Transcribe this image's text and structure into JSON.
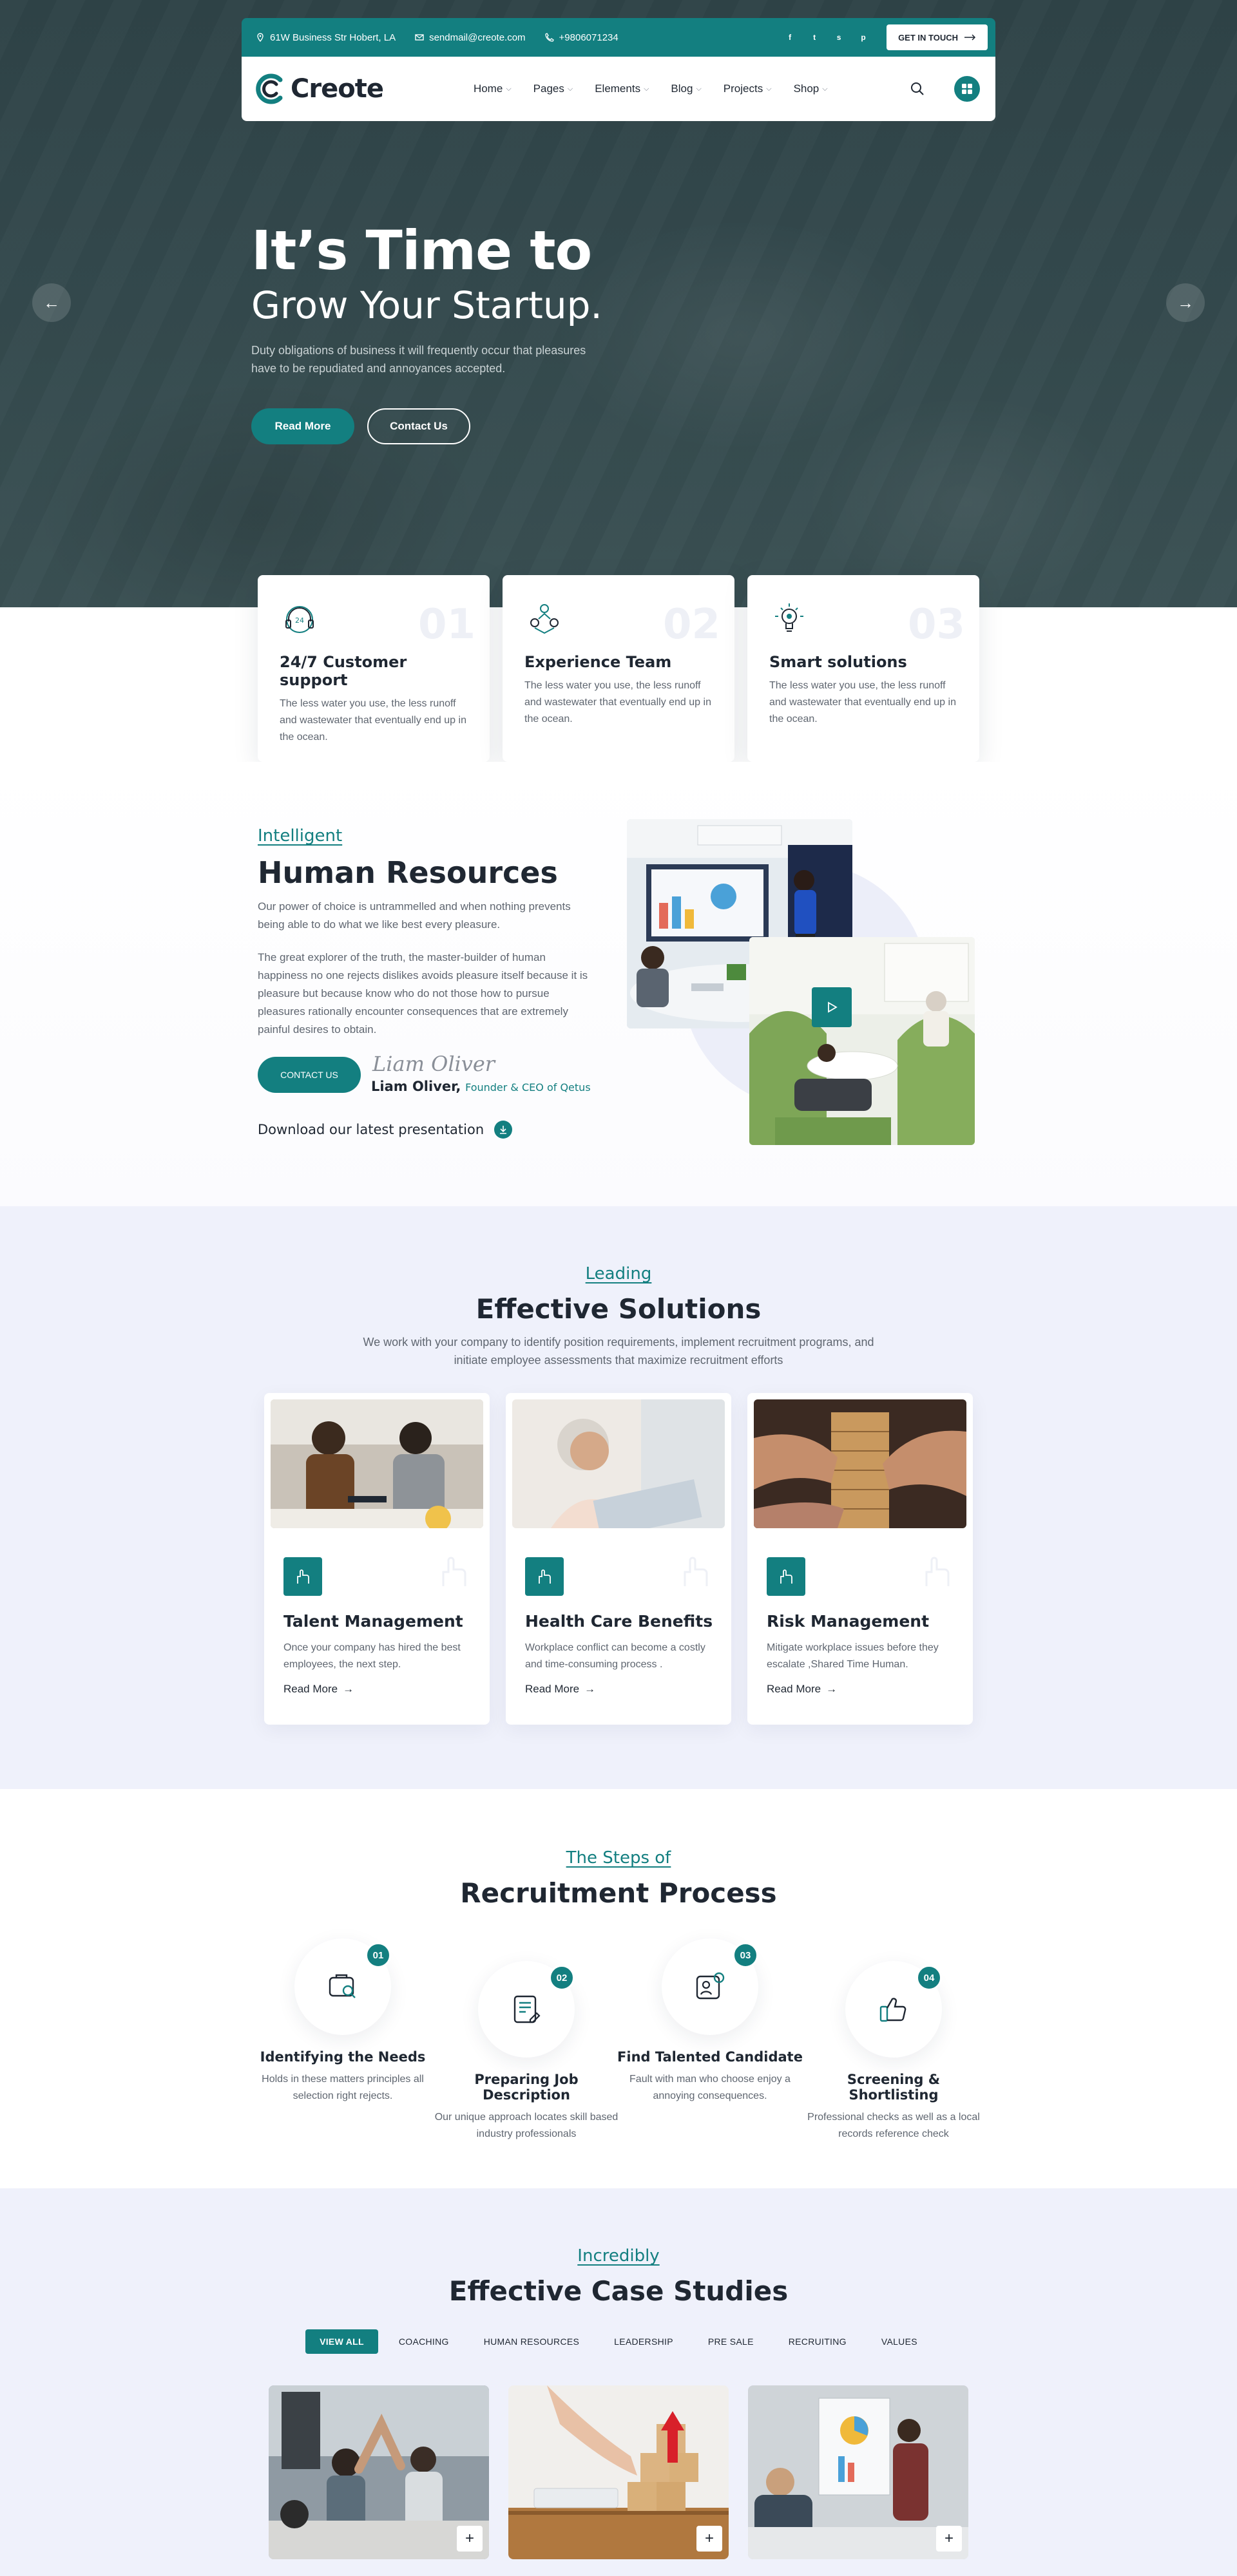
{
  "topbar": {
    "address": "61W Business Str Hobert, LA",
    "email": "sendmail@creote.com",
    "phone": "+9806071234",
    "social": [
      "f",
      "t",
      "s",
      "p"
    ],
    "cta": "GET IN TOUCH"
  },
  "nav": {
    "logo": "Creote",
    "items": [
      "Home",
      "Pages",
      "Elements",
      "Blog",
      "Projects",
      "Shop"
    ]
  },
  "hero": {
    "title_line1": "It’s Time to",
    "title_line2": "Grow Your Startup.",
    "description": "Duty obligations of business it will frequently occur that pleasures have to be repudiated and annoyances accepted.",
    "btn_primary": "Read More",
    "btn_secondary": "Contact Us"
  },
  "features": [
    {
      "num": "01",
      "title": "24/7 Customer support",
      "text": "The less water you use, the less runoff and wastewater that eventually end up in the ocean.",
      "icon": "headset-icon"
    },
    {
      "num": "02",
      "title": "Experience Team",
      "text": "The less water you use, the less runoff and wastewater that eventually end up in the ocean.",
      "icon": "team-icon"
    },
    {
      "num": "03",
      "title": "Smart solutions",
      "text": "The less water you use, the less runoff and wastewater that eventually end up in the ocean.",
      "icon": "bulb-icon"
    }
  ],
  "about": {
    "subtitle": "Intelligent",
    "title": "Human Resources",
    "p1": "Our power of choice is untrammelled and when nothing prevents being able to do what we like best every pleasure.",
    "p2": "The great explorer of the truth, the master-builder of human happiness no one rejects dislikes avoids pleasure itself because it is pleasure but because know who do not those how to pursue pleasures rationally encounter consequences that are extremely painful desires to obtain.",
    "contact_btn": "CONTACT US",
    "signature": "Liam Oliver",
    "name": "Liam Oliver,",
    "role": "Founder & CEO of Qetus",
    "download": "Download our latest presentation"
  },
  "solutions": {
    "subtitle": "Leading",
    "title": "Effective Solutions",
    "description": "We work with your company to identify position requirements, implement recruitment programs, and initiate employee assessments that maximize recruitment efforts",
    "cards": [
      {
        "title": "Talent Management",
        "text": "Once your company has hired the best employees, the next step.",
        "link": "Read More"
      },
      {
        "title": "Health Care Benefits",
        "text": "Workplace conflict can become a costly and time-consuming process .",
        "link": "Read More"
      },
      {
        "title": "Risk Management",
        "text": "Mitigate workplace issues before they escalate ,Shared Time Human.",
        "link": "Read More"
      }
    ]
  },
  "process": {
    "subtitle": "The Steps of",
    "title": "Recruitment Process",
    "steps": [
      {
        "num": "01",
        "title": "Identifying the Needs",
        "text": "Holds in these matters principles all selection right rejects."
      },
      {
        "num": "02",
        "title": "Preparing Job Description",
        "text": "Our unique approach locates skill based industry professionals"
      },
      {
        "num": "03",
        "title": "Find Talented Candidate",
        "text": "Fault with man who choose enjoy a annoying consequences."
      },
      {
        "num": "04",
        "title": "Screening & Shortlisting",
        "text": "Professional checks as well as a local records reference check"
      }
    ]
  },
  "cases": {
    "subtitle": "Incredibly",
    "title": "Effective Case Studies",
    "filters": [
      "VIEW ALL",
      "COACHING",
      "HUMAN RESOURCES",
      "LEADERSHIP",
      "PRE SALE",
      "RECRUITING",
      "VALUES"
    ],
    "plus": "+"
  },
  "colors": {
    "accent": "#137f80",
    "dark": "#1f2732",
    "light_bg": "#eff1fb"
  }
}
